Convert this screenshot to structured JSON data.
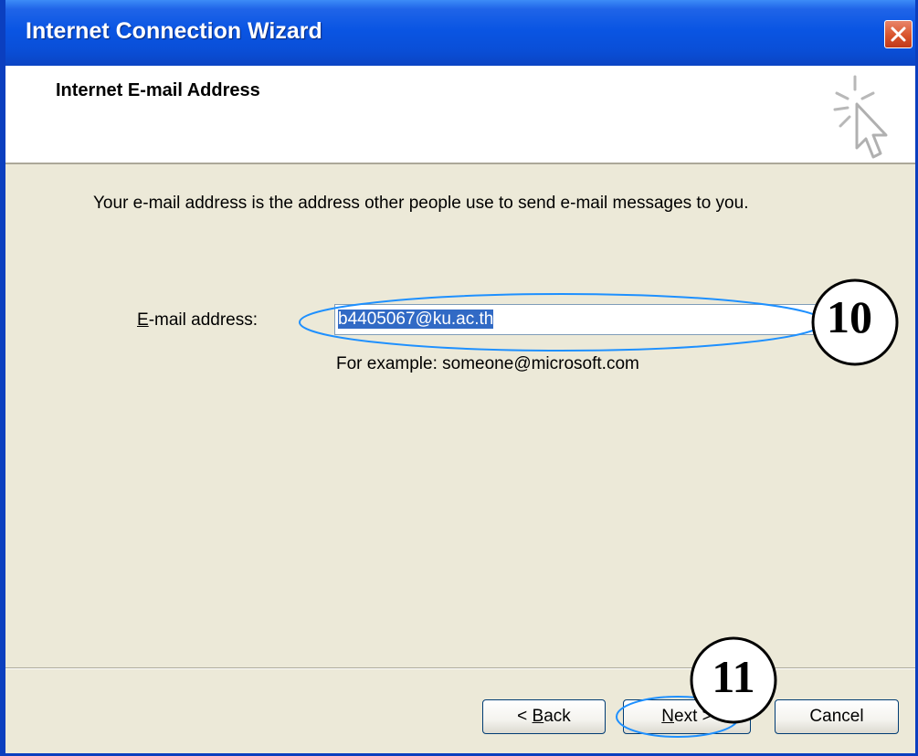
{
  "window": {
    "title": "Internet Connection Wizard",
    "close_icon": "close-icon"
  },
  "header": {
    "title": "Internet E-mail Address",
    "icon": "wizard-cursor-icon"
  },
  "body": {
    "intro": "Your e-mail address is the address other people use to send e-mail messages to you.",
    "email_label_accel": "E",
    "email_label_rest": "-mail address:",
    "email_value": "b4405067@ku.ac.th",
    "example": "For example: someone@microsoft.com"
  },
  "buttons": {
    "back_prefix": "< ",
    "back_accel": "B",
    "back_rest": "ack",
    "next_accel": "N",
    "next_rest": "ext >",
    "cancel": "Cancel"
  },
  "callouts": [
    {
      "label": "10"
    },
    {
      "label": "11"
    }
  ],
  "colors": {
    "titlebar": "#0a55e3",
    "dialog_bg": "#ece9d8",
    "selection": "#316ac5",
    "callout_ellipse": "#1e90ff"
  }
}
